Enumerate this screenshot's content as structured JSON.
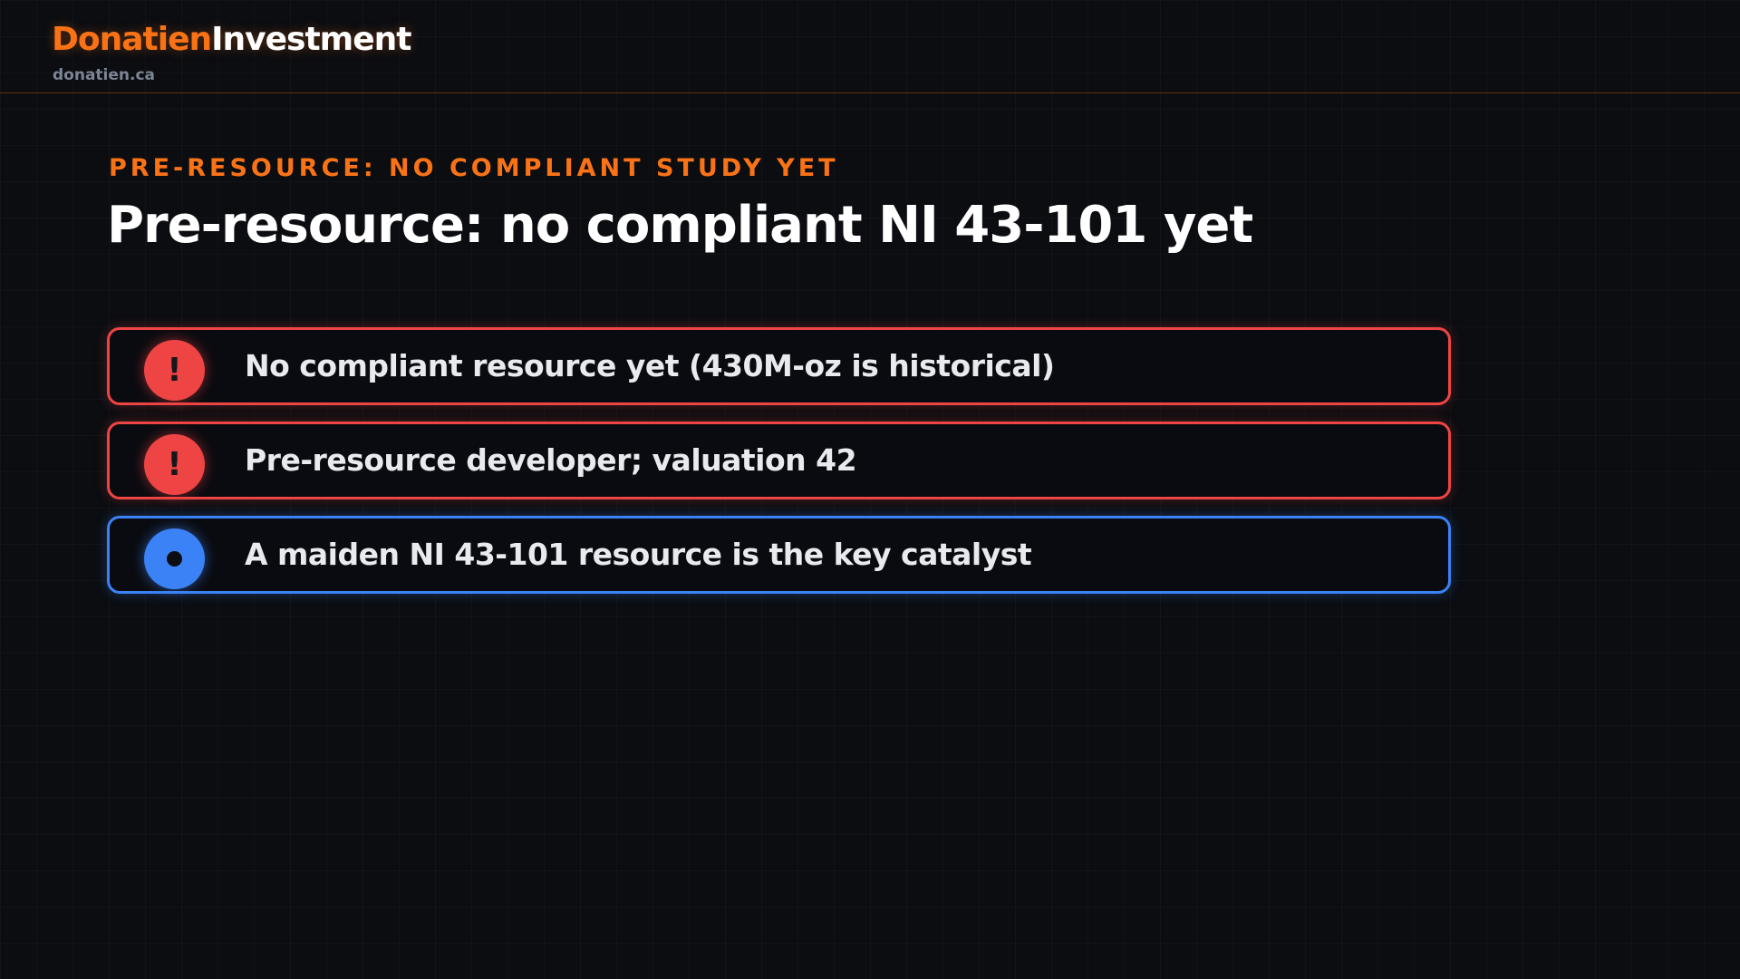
{
  "header": {
    "brand_primary": "Donatien",
    "brand_secondary": "Investment",
    "domain": "donatien.ca"
  },
  "slide": {
    "kicker": "PRE-RESOURCE: NO COMPLIANT STUDY YET",
    "title": "Pre-resource: no compliant NI 43-101 yet",
    "items": [
      {
        "text": "No compliant resource yet (430M-oz is historical)",
        "kind": "warning",
        "icon": "exclamation-icon",
        "color": "#ef4444"
      },
      {
        "text": "Pre-resource developer; valuation 42",
        "kind": "warning",
        "icon": "exclamation-icon",
        "color": "#ef4444"
      },
      {
        "text": "A maiden NI 43-101 resource is the key catalyst",
        "kind": "info",
        "icon": "dot-icon",
        "color": "#3b82f6"
      }
    ]
  },
  "colors": {
    "accent": "#f97316",
    "background": "#0b0d11",
    "warning": "#ef4444",
    "info": "#3b82f6"
  },
  "glyphs": {
    "exclamation": "!"
  }
}
